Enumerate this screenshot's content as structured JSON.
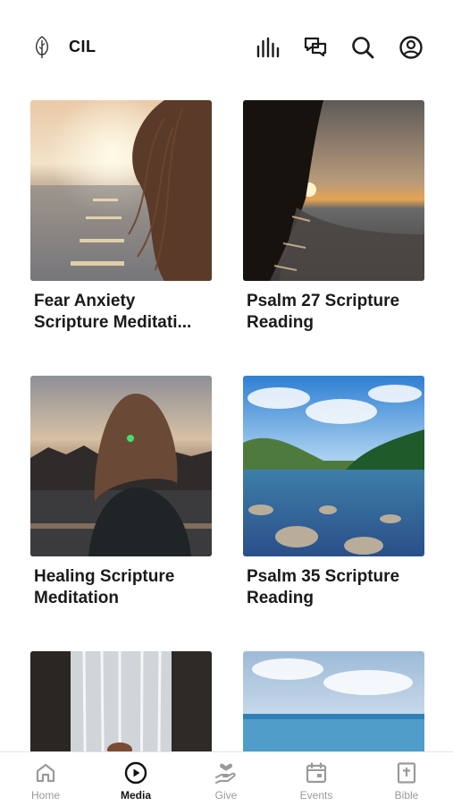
{
  "header": {
    "app_name": "CIL",
    "icons": [
      "leaf-logo",
      "audio-bars-icon",
      "chat-bubbles-icon",
      "search-icon",
      "account-icon"
    ]
  },
  "media": {
    "items": [
      {
        "title": "Fear Anxiety Scripture Meditati..."
      },
      {
        "title": "Psalm 27 Scripture Reading"
      },
      {
        "title": "Healing Scripture Meditation"
      },
      {
        "title": "Psalm 35 Scripture Reading"
      },
      {
        "title": ""
      },
      {
        "title": ""
      }
    ]
  },
  "tabbar": {
    "tabs": [
      {
        "label": "Home",
        "icon": "home-icon",
        "active": false
      },
      {
        "label": "Media",
        "icon": "play-circle-icon",
        "active": true
      },
      {
        "label": "Give",
        "icon": "give-heart-hand-icon",
        "active": false
      },
      {
        "label": "Events",
        "icon": "calendar-icon",
        "active": false
      },
      {
        "label": "Bible",
        "icon": "bible-icon",
        "active": false
      }
    ]
  },
  "colors": {
    "active": "#111111",
    "inactive": "#9a9a9a",
    "divider": "#e6e6e6"
  }
}
